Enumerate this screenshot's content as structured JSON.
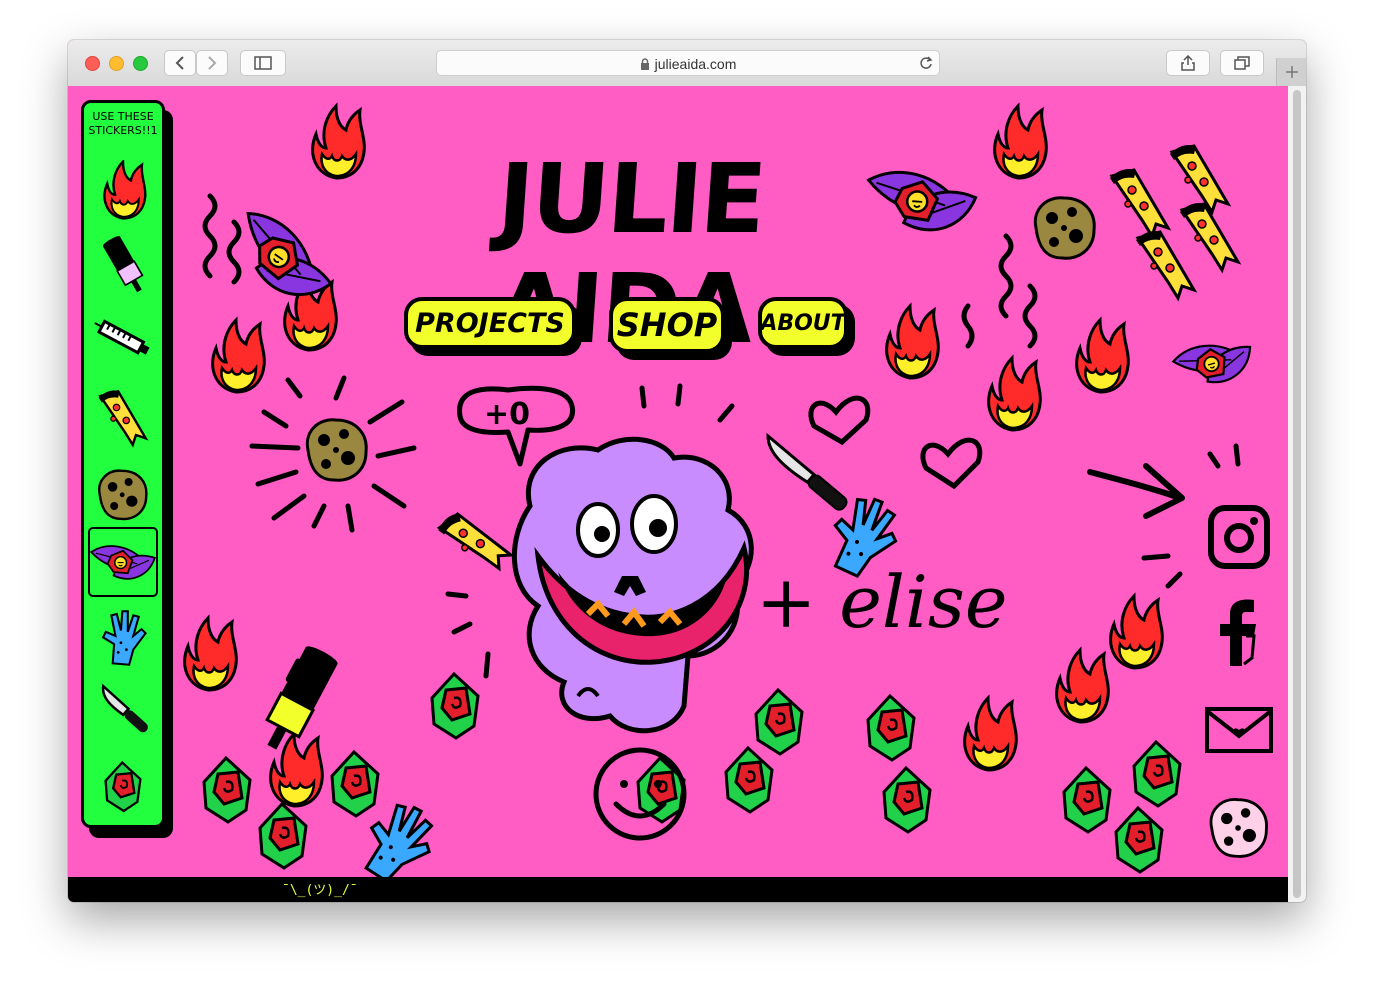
{
  "browser": {
    "url": "julieaida.com",
    "icons": [
      "close-light",
      "minimize-light",
      "zoom-light",
      "back-icon",
      "forward-icon",
      "sidebar-icon",
      "lock-icon",
      "reload-icon",
      "share-icon",
      "tabs-icon",
      "new-tab-icon"
    ]
  },
  "sticker_panel": {
    "title": "USE THESE STICKERS!!1",
    "stickers": [
      "flame-icon",
      "popsicle-icon",
      "syringe-icon",
      "pizza-icon",
      "cookie-icon",
      "rose-leaf-icon",
      "hand-icon",
      "knife-icon",
      "flower-icon"
    ],
    "selected_index": 5
  },
  "header": {
    "logo_text": "JULIE AIDA"
  },
  "nav": {
    "projects_label": "PROJECTS",
    "shop_label": "SHOP",
    "about_label": "ABOUT"
  },
  "collaborator": {
    "text": "+ elise"
  },
  "speech_bubble": {
    "text": "+0"
  },
  "social": [
    "instagram-icon",
    "facebook-icon",
    "email-icon",
    "cookie-icon"
  ],
  "footer": {
    "text": "¯\\_(ツ)_/¯"
  },
  "colors": {
    "background": "#ff5cc4",
    "panel": "#22ff3e",
    "nav_button": "#f2ff2a",
    "blob": "#c98cff",
    "flame_red": "#ff2b2b",
    "flame_yellow": "#ffee2a",
    "leaf_green": "#22d14a",
    "rose_red": "#e31f2b",
    "leaf_purple": "#8a36e0",
    "footer": "#000000",
    "shrug": "#e8ff3a"
  }
}
